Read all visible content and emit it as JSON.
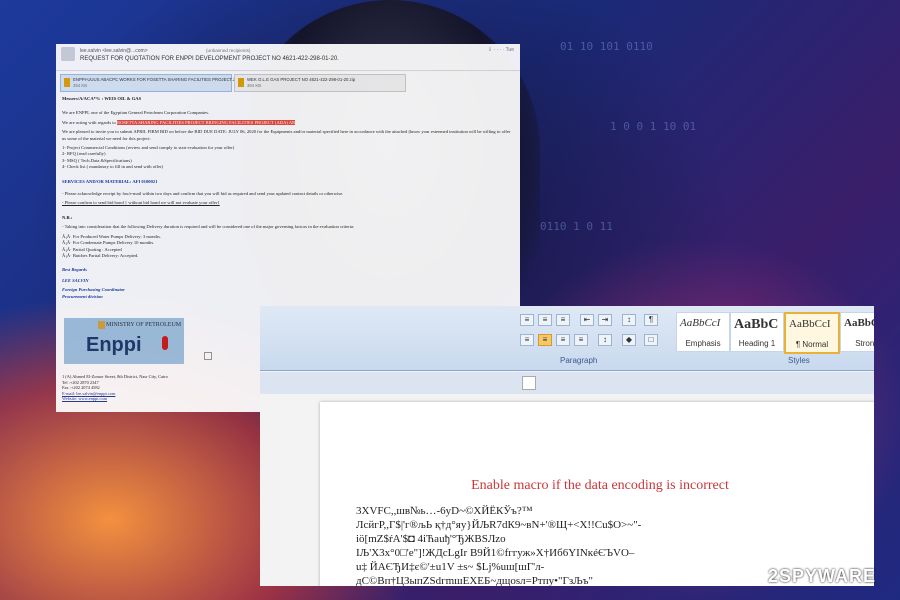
{
  "email": {
    "from": "lee.salvin <lee.salvin@...com>",
    "external": "(unbanned recipients)",
    "subject": "REQUEST FOR QUOTATION FOR ENPPI DEVELOPMENT PROJECT NO 4621-422-298-01-20.",
    "icons": "⇩ ·  ·  · · Tue",
    "attachments": [
      {
        "name": "ENPPI-UUUS ABACPC WORKS FOR FOSETTA SHARING FACILITIES PROJECT.zip",
        "size": "394 KB"
      },
      {
        "name": "WEK O.L.E GAS PROJECT NO 4621-422-298-01-20.zip",
        "size": "394 KB"
      }
    ],
    "greeting": "Messers/A/ACA*%   :   WEIS OIL & GAS",
    "intro1": "We are ENPPI, one of the Egyptian General Petroleum Corporation Companies.",
    "intro2_prefix": "We are acting with regards to ",
    "intro2_highlight": "ROSETTA SHARING FACILITIES PROJECT BRINGING FACILITIES PROJECT (ADA) AR",
    "intro3": "We are pleased to invite you to submit APRIL FIRM BID on before the BID DUE DATE: JULY 06, 2020 for the Equipments and/or material specified here in accordance with the attached (know your esteemed institution will be willing to offer us some of the material we need for this project:",
    "list": [
      "1-     Project Commercial Conditions (review and send comply to start evaluation for your offer)",
      "2-     RFQ (read carefully)",
      "3-     MSQ  ( Tech.Data &Specifications)",
      "4-     Check list ( mandatory to fill in and send with offer)"
    ],
    "services": "SERVICES AND/OR MATERIAL:     AFI 0100021",
    "ack1": "-        Please acknowledge receipt by fax/e-mail within two days and confirm that you will bid as required and send your updated contact details or otherwise.",
    "ack2": "-        Please confirm to send bid bond { without bid bond we will not evaluate your offer}",
    "nb": "N.B.:",
    "nb_line": "-    Taking into consideration that the following Delivery duration is required and will be considered one of the major governing factors in the evaluation criteria:",
    "delivery": [
      "Â¡Â·   For Produced Water Pumps Delivery: 3 months.",
      "Â¡Â·   For Condensate Pumps Delivery 10 months.",
      "Â¡Â·   Partial Quoting : Accepted",
      "Â¡Â·   Batches Partial Delivery: Accepted."
    ],
    "regards": "Best Regards",
    "name": "LEE SALVIN",
    "role1": "Foreign Purchasing Coordinator",
    "role2": "Procurement division",
    "logo_ministry": "MINISTRY OF PETROLEUM",
    "logo_brand": "Enppi",
    "address": [
      "1 (A) Ahmed El-Zomor Street, 8th District, Nasr City, Cairo",
      "Tel      :+202 2870 2347",
      "Fax     :+202 2074 4582",
      "E-mail: lee.salvin@enppi.com",
      "Website: www.enppi.com"
    ]
  },
  "word": {
    "paragraph_label": "Paragraph",
    "styles_label": "Styles",
    "styles": [
      {
        "sample": "AaBbCcI",
        "name": "Emphasis"
      },
      {
        "sample": "AaBbC",
        "name": "Heading 1"
      },
      {
        "sample": "AaBbCcI",
        "name": "¶ Normal"
      },
      {
        "sample": "AaBbC",
        "name": "Strong"
      }
    ],
    "enable_text": "Enable macro if the data encoding is incorrect",
    "garbled": [
      "3XVFC,,шв№ь…-6уD~©ХЙЁКЎъ?™",
      "ЛсйгР,,Г$|'г®љЬ қ†д°яу}ЙЉR7dК9~вN+'®Щ+<X!!Cu$O>~\"-",
      "iö[mZ$ŕA'$◘ 4iЋаuђ'°ЂЖBSЛzо",
      "IЉ'X3x°0□'e\"]!ЖДсLgIr   В9Й1©fггуж»Х†Иб6YINкéЄЪVO–",
      "u‡ ЙАЄЂИ‡є©'±u1V   ±s~ $Lj%uш[шГ'л-",
      "дС©Вп†ЦЗыпZSdгmшЕХЕБ~дщоsл=Ртпу•\"ГзЉъ\""
    ]
  },
  "watermark": "2SPYWARE"
}
